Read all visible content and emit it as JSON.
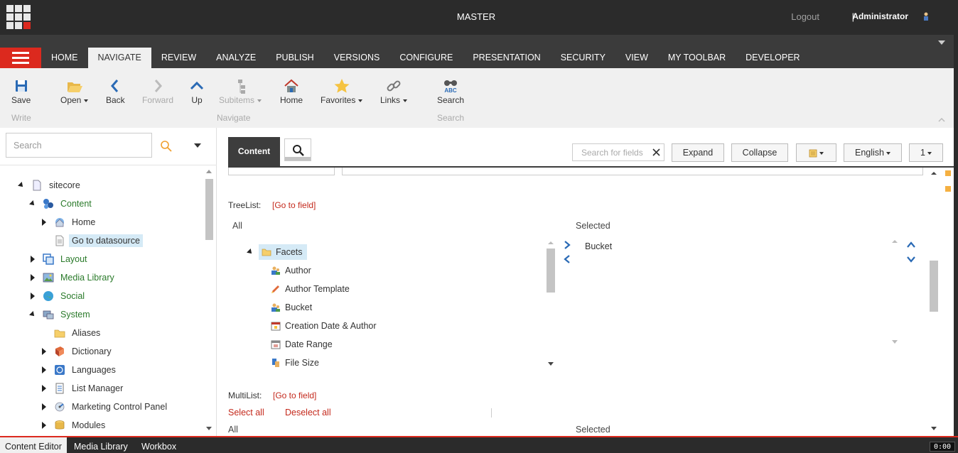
{
  "header": {
    "database": "MASTER",
    "logout_label": "Logout",
    "separator": "|",
    "user": "Administrator"
  },
  "tabs": [
    {
      "label": "HOME"
    },
    {
      "label": "NAVIGATE",
      "active": true
    },
    {
      "label": "REVIEW"
    },
    {
      "label": "ANALYZE"
    },
    {
      "label": "PUBLISH"
    },
    {
      "label": "VERSIONS"
    },
    {
      "label": "CONFIGURE"
    },
    {
      "label": "PRESENTATION"
    },
    {
      "label": "SECURITY"
    },
    {
      "label": "VIEW"
    },
    {
      "label": "MY TOOLBAR"
    },
    {
      "label": "DEVELOPER"
    }
  ],
  "ribbon": {
    "save": "Save",
    "open": "Open",
    "back": "Back",
    "forward": "Forward",
    "up": "Up",
    "subitems": "Subitems",
    "home": "Home",
    "favorites": "Favorites",
    "links": "Links",
    "search": "Search",
    "group_write": "Write",
    "group_navigate": "Navigate",
    "group_search": "Search"
  },
  "left": {
    "search_placeholder": "Search",
    "tree": {
      "sitecore": "sitecore",
      "content": "Content",
      "home": "Home",
      "go_to_datasource": "Go to datasource",
      "layout": "Layout",
      "media_library": "Media Library",
      "social": "Social",
      "system": "System",
      "aliases": "Aliases",
      "dictionary": "Dictionary",
      "languages": "Languages",
      "list_manager": "List Manager",
      "marketing_control_panel": "Marketing Control Panel",
      "modules": "Modules"
    }
  },
  "editor": {
    "content_tab": "Content",
    "field_search_placeholder": "Search for fields",
    "expand": "Expand",
    "collapse": "Collapse",
    "language": "English",
    "version": "1",
    "treelist": {
      "label": "TreeList:",
      "goto": "[Go to field]",
      "all": "All",
      "selected": "Selected",
      "items": {
        "facets": "Facets",
        "author": "Author",
        "author_template": "Author Template",
        "bucket": "Bucket",
        "creation_date_author": "Creation Date & Author",
        "date_range": "Date Range",
        "file_size": "File Size"
      },
      "selected_items": [
        "Bucket"
      ]
    },
    "multilist": {
      "label": "MultiList:",
      "goto": "[Go to field]",
      "select_all": "Select all",
      "deselect_all": "Deselect all",
      "all": "All",
      "selected": "Selected"
    }
  },
  "bottom": {
    "tabs": [
      {
        "label": "Content Editor",
        "active": true
      },
      {
        "label": "Media Library"
      },
      {
        "label": "Workbox"
      }
    ],
    "clock": "0:00"
  },
  "colors": {
    "brand_red": "#dc291e",
    "dark_bar": "#2b2b2b",
    "tree_green": "#2a7a2a",
    "selection_blue": "#d5eaf6",
    "link_red": "#c4291c"
  }
}
